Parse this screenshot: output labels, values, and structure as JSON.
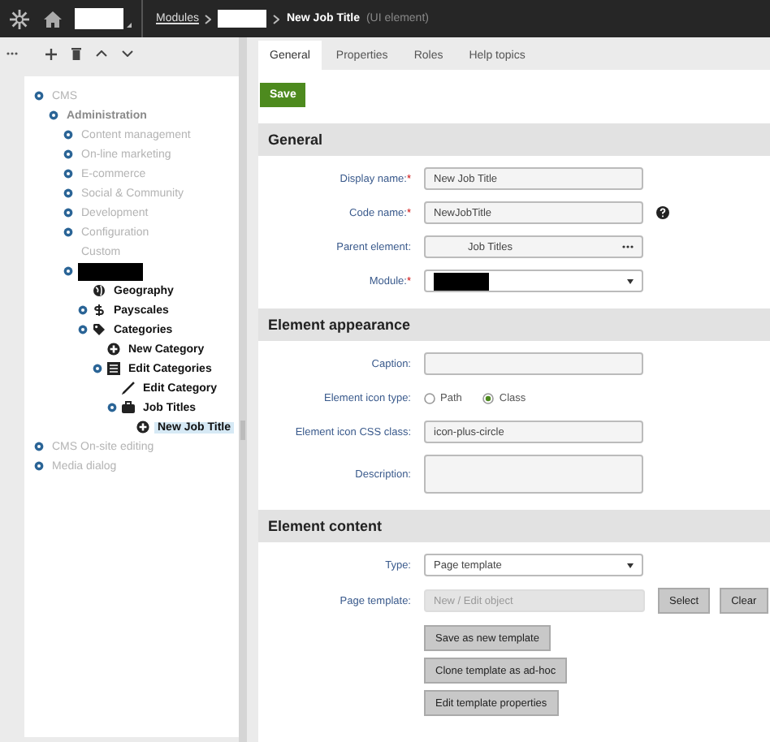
{
  "top_bar": {
    "breadcrumb": [
      {
        "kind": "redacted"
      },
      {
        "kind": "link",
        "label": "Modules"
      },
      {
        "kind": "redacted"
      },
      {
        "kind": "current",
        "label": "New Job Title",
        "note": "(UI element)"
      }
    ]
  },
  "tree": [
    {
      "label": "CMS",
      "toggle": true,
      "dimmed": true,
      "children": [
        {
          "label": "Administration",
          "toggle": true,
          "dimmed": true,
          "bold": true,
          "children": [
            {
              "label": "Content management",
              "toggle": true,
              "dimmed": true
            },
            {
              "label": "On-line marketing",
              "toggle": true,
              "dimmed": true
            },
            {
              "label": "E-commerce",
              "toggle": true,
              "dimmed": true
            },
            {
              "label": "Social & Community",
              "toggle": true,
              "dimmed": true
            },
            {
              "label": "Development",
              "toggle": true,
              "dimmed": true
            },
            {
              "label": "Configuration",
              "toggle": true,
              "dimmed": true
            },
            {
              "label": "Custom",
              "toggle": false,
              "dimmed": true
            },
            {
              "redacted": true,
              "toggle": true,
              "dimmed": false,
              "children": [
                {
                  "label": "Geography",
                  "toggle": false,
                  "dimmed": false,
                  "bold": true,
                  "kind": "globe"
                },
                {
                  "label": "Payscales",
                  "toggle": true,
                  "dimmed": false,
                  "bold": true,
                  "kind": "dollar"
                },
                {
                  "label": "Categories",
                  "toggle": true,
                  "dimmed": false,
                  "bold": true,
                  "kind": "tag",
                  "children": [
                    {
                      "label": "New Category",
                      "toggle": false,
                      "dimmed": false,
                      "bold": true,
                      "kind": "plus-circle"
                    },
                    {
                      "label": "Edit Categories",
                      "toggle": true,
                      "dimmed": false,
                      "bold": true,
                      "kind": "list",
                      "children": [
                        {
                          "label": "Edit Category",
                          "toggle": false,
                          "dimmed": false,
                          "bold": true,
                          "kind": "pencil"
                        },
                        {
                          "label": "Job Titles",
                          "toggle": true,
                          "dimmed": false,
                          "bold": true,
                          "kind": "briefcase",
                          "children": [
                            {
                              "label": "New Job Title",
                              "toggle": false,
                              "dimmed": false,
                              "bold": true,
                              "kind": "plus-circle",
                              "selected": true
                            }
                          ]
                        }
                      ]
                    }
                  ]
                }
              ]
            }
          ]
        }
      ]
    },
    {
      "label": "CMS On-site editing",
      "toggle": true,
      "dimmed": true
    },
    {
      "label": "Media dialog",
      "toggle": true,
      "dimmed": true
    }
  ],
  "tabs": [
    {
      "label": "General",
      "selected": true
    },
    {
      "label": "Properties",
      "selected": false
    },
    {
      "label": "Roles",
      "selected": false
    },
    {
      "label": "Help topics",
      "selected": false
    }
  ],
  "save_button": "Save",
  "sections": [
    {
      "title": "General",
      "fields": [
        {
          "kind": "text",
          "label": "Display name:",
          "required": "*",
          "value": "New Job Title"
        },
        {
          "kind": "text",
          "label": "Code name:",
          "required": "*",
          "value": "NewJobTitle",
          "help": true
        },
        {
          "kind": "picker",
          "label": "Parent element:",
          "value": "Job Titles"
        },
        {
          "kind": "select",
          "label": "Module:",
          "required": "*",
          "redacted": true
        }
      ]
    },
    {
      "title": "Element appearance",
      "fields": [
        {
          "kind": "text",
          "label": "Caption:"
        },
        {
          "kind": "radio",
          "label": "Element icon type:",
          "options": [
            {
              "label": "Path",
              "selected": false
            },
            {
              "label": "Class",
              "selected": true
            }
          ]
        },
        {
          "kind": "text",
          "label": "Element icon CSS class:",
          "value": "icon-plus-circle"
        },
        {
          "kind": "textarea",
          "label": "Description:"
        }
      ]
    },
    {
      "title": "Element content",
      "fields": [
        {
          "kind": "select",
          "label": "Type:",
          "value": "Page template"
        },
        {
          "kind": "selector",
          "label": "Page template:",
          "placeholder": "New / Edit object",
          "buttons": [
            "Select",
            "Clear"
          ]
        },
        {
          "kind": "buttons",
          "buttons": [
            "Save as new template",
            "Clone template as ad-hoc",
            "Edit template properties"
          ]
        }
      ]
    }
  ]
}
